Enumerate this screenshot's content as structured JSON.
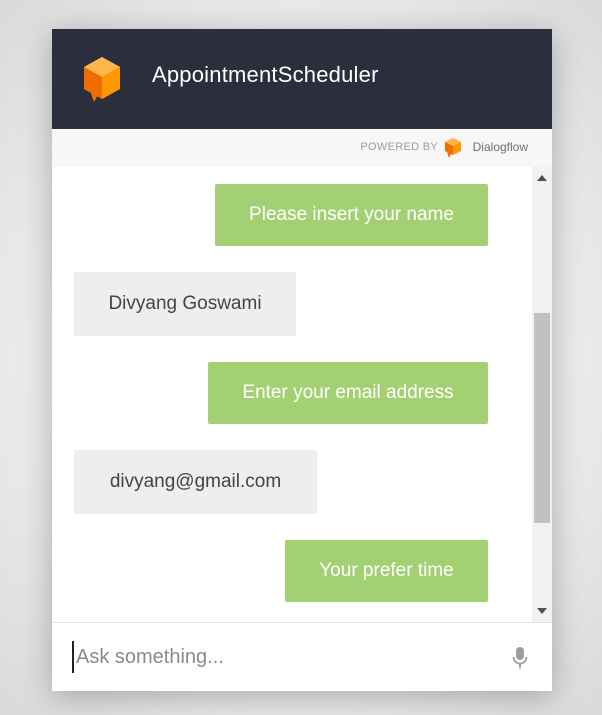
{
  "header": {
    "title": "AppointmentScheduler",
    "logo_icon": "dialogflow-cube-icon",
    "background": "#2b2f3d"
  },
  "powered_by": {
    "label": "POWERED BY",
    "brand": "Dialogflow",
    "brand_icon": "dialogflow-logo-icon"
  },
  "messages": [
    {
      "from": "bot",
      "text": "Please insert your name"
    },
    {
      "from": "user",
      "text": "Divyang Goswami"
    },
    {
      "from": "bot",
      "text": "Enter your email address"
    },
    {
      "from": "user",
      "text": "divyang@gmail.com"
    },
    {
      "from": "bot",
      "text": "Your prefer time"
    }
  ],
  "colors": {
    "bot_bubble": "#a3d072",
    "user_bubble": "#eeeeef",
    "accent": "#ff9800"
  },
  "input": {
    "placeholder": "Ask something...",
    "value": "",
    "mic_icon": "microphone-icon"
  }
}
